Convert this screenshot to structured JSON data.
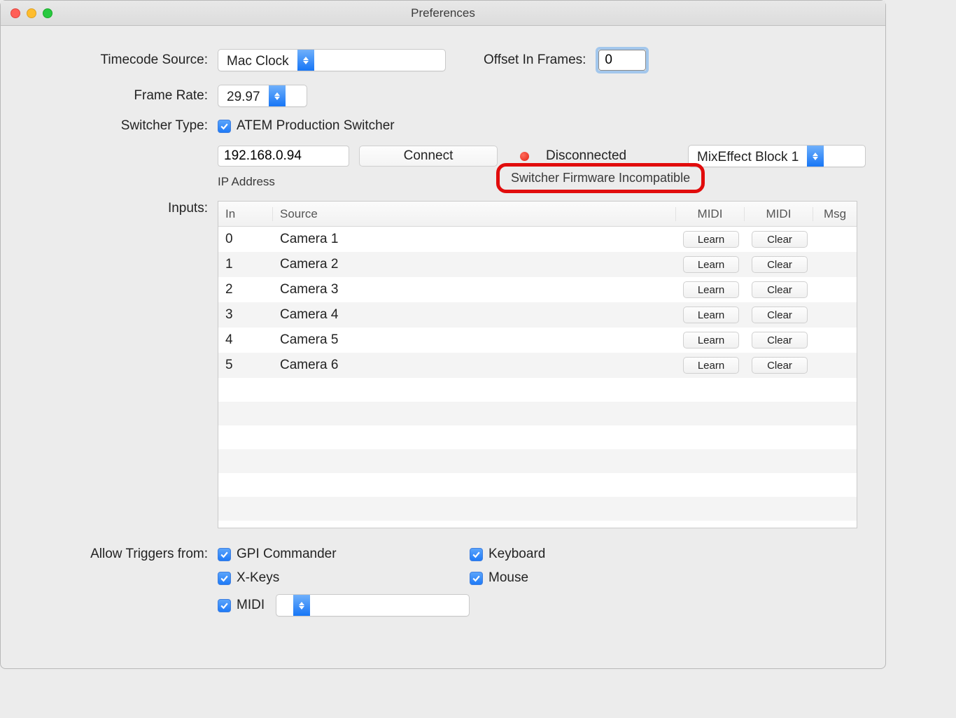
{
  "window": {
    "title": "Preferences"
  },
  "timecode": {
    "label": "Timecode Source:",
    "value": "Mac Clock",
    "offset_label": "Offset In Frames:",
    "offset_value": "0"
  },
  "framerate": {
    "label": "Frame Rate:",
    "value": "29.97"
  },
  "switcher": {
    "label": "Switcher Type:",
    "checkbox_label": "ATEM Production Switcher",
    "ip": "192.168.0.94",
    "ip_label": "IP Address",
    "connect": "Connect",
    "status": "Disconnected",
    "mixeffect": "MixEffect Block 1",
    "callout": "Switcher Firmware Incompatible"
  },
  "inputs": {
    "label": "Inputs:",
    "headers": {
      "in": "In",
      "source": "Source",
      "midi1": "MIDI",
      "midi2": "MIDI",
      "msg": "Msg"
    },
    "learn": "Learn",
    "clear": "Clear",
    "rows": [
      {
        "in": "0",
        "source": "Camera 1"
      },
      {
        "in": "1",
        "source": "Camera 2"
      },
      {
        "in": "2",
        "source": "Camera 3"
      },
      {
        "in": "3",
        "source": "Camera 4"
      },
      {
        "in": "4",
        "source": "Camera 5"
      },
      {
        "in": "5",
        "source": "Camera 6"
      }
    ]
  },
  "triggers": {
    "label": "Allow Triggers from:",
    "gpi": "GPI Commander",
    "keyboard": "Keyboard",
    "xkeys": "X-Keys",
    "mouse": "Mouse",
    "midi": "MIDI",
    "midi_select": ""
  }
}
